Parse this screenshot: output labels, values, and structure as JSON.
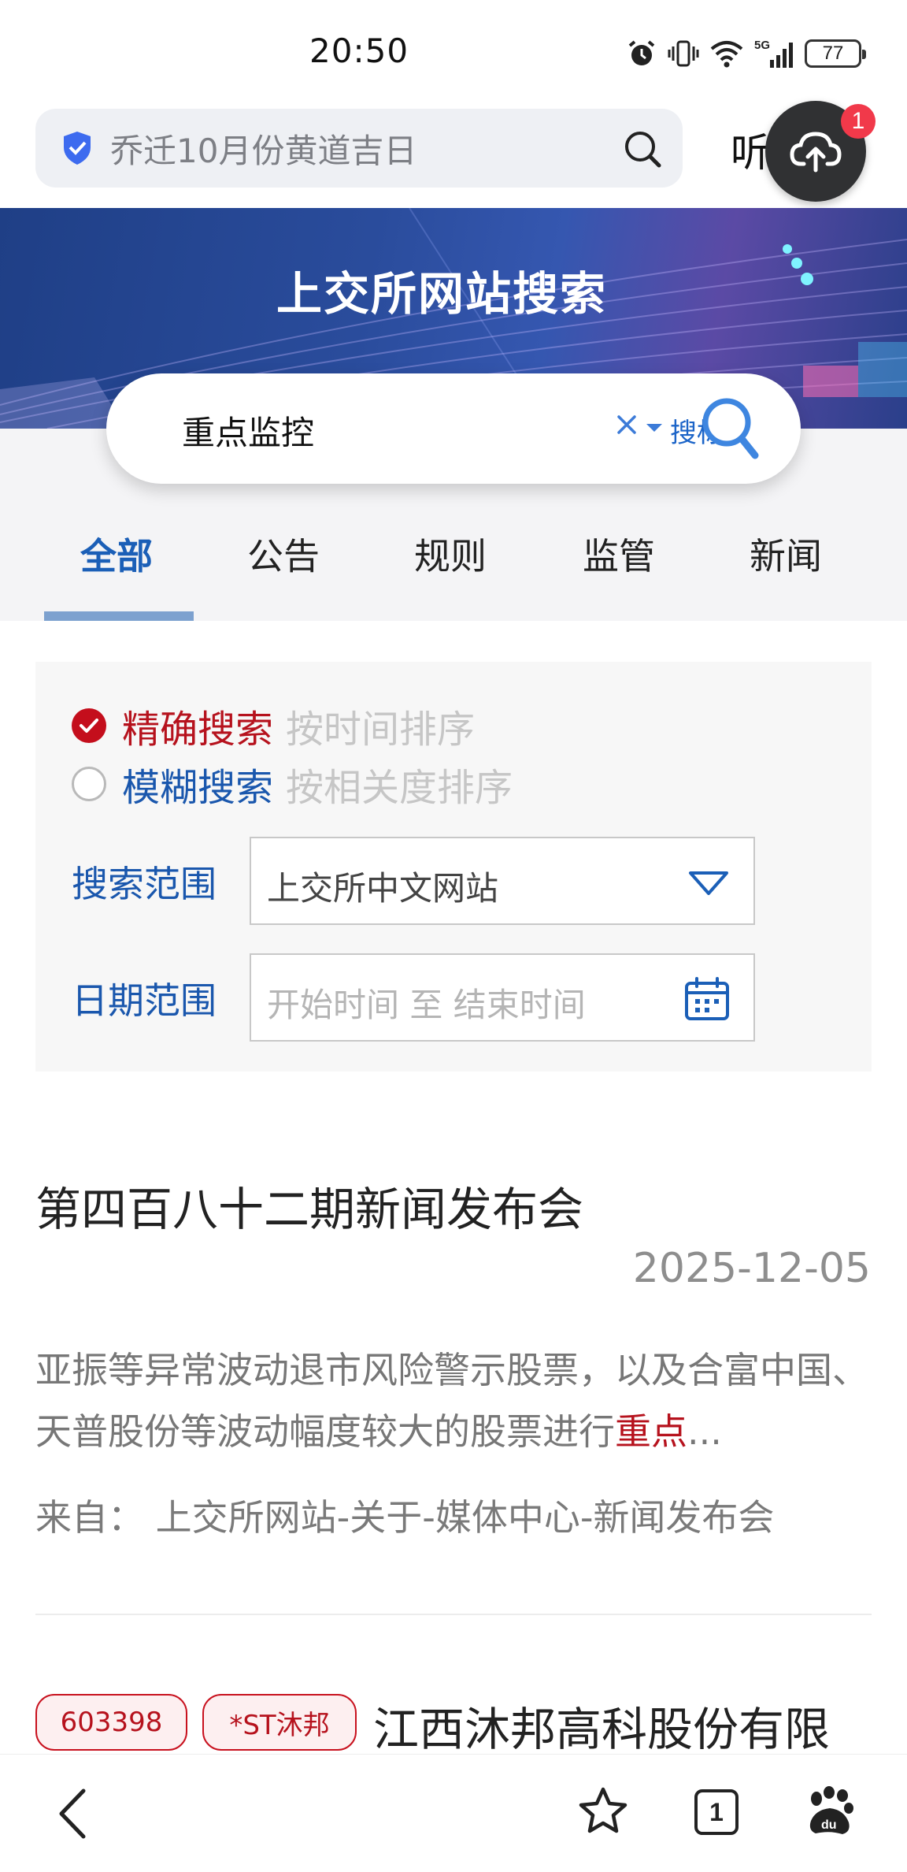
{
  "status_bar": {
    "time": "20:50",
    "signal": "5G",
    "battery": "77"
  },
  "browser_bar": {
    "search_text": "乔迁10月份黄道吉日",
    "listen_label": "听",
    "upload_badge": "1"
  },
  "banner": {
    "title": "上交所网站搜索"
  },
  "search": {
    "query": "重点监控",
    "clear_symbol": "×",
    "scope_label": "搜标..."
  },
  "tabs": [
    {
      "label": "全部",
      "active": true
    },
    {
      "label": "公告",
      "active": false
    },
    {
      "label": "规则",
      "active": false
    },
    {
      "label": "监管",
      "active": false
    },
    {
      "label": "新闻",
      "active": false
    }
  ],
  "filters": {
    "exact": {
      "label": "精确搜索",
      "hint": "按时间排序",
      "checked": true
    },
    "fuzzy": {
      "label": "模糊搜索",
      "hint": "按相关度排序",
      "checked": false
    },
    "range": {
      "label": "搜索范围",
      "value": "上交所中文网站"
    },
    "date": {
      "label": "日期范围",
      "placeholder": "开始时间 至 结束时间"
    }
  },
  "results": [
    {
      "title": "第四百八十二期新闻发布会",
      "date": "2025-12-05",
      "snippet_before": "亚振等异常波动退市风险警示股票，以及合富中国、天普股份等波动幅度较大的股票进行",
      "snippet_highlight": "重点",
      "snippet_after": "...",
      "source": "来自： 上交所网站-关于-媒体中心-新闻发布会"
    },
    {
      "code_badge": "603398",
      "name_badge": "*ST沐邦",
      "title": "江西沐邦高科股份有限"
    }
  ],
  "bottom_nav": {
    "tab_count": "1"
  },
  "colors": {
    "accent_blue": "#1a57ad",
    "accent_red": "#b6121d"
  }
}
